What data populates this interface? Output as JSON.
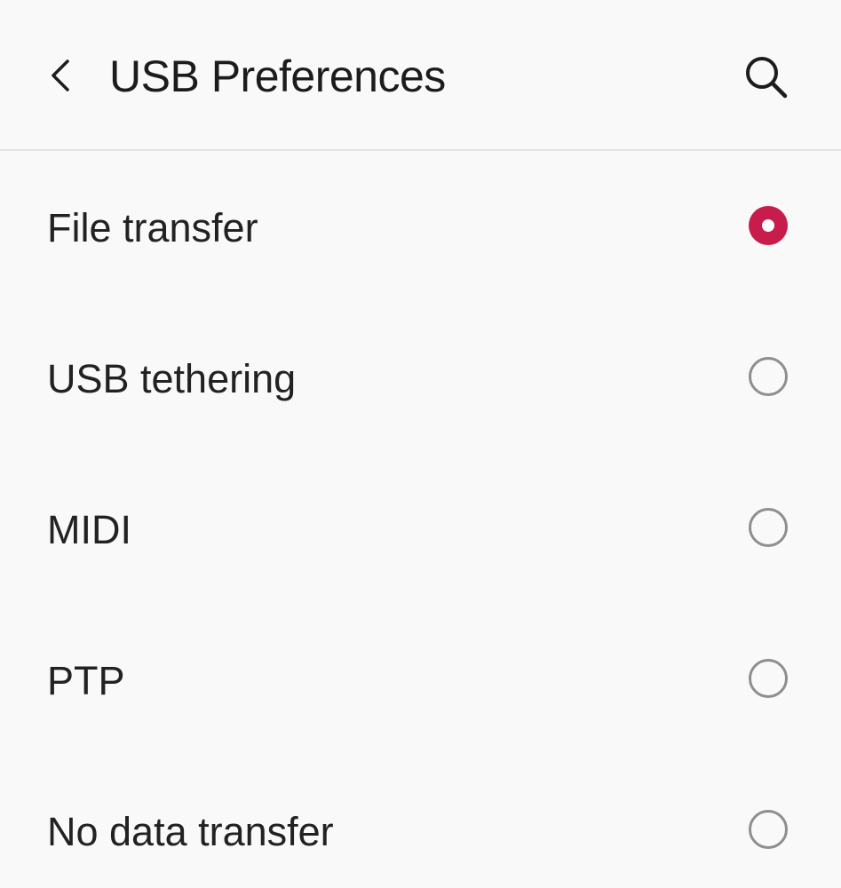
{
  "header": {
    "title": "USB Preferences",
    "back_icon": "chevron-left-icon",
    "search_icon": "search-icon"
  },
  "options": [
    {
      "label": "File transfer",
      "selected": true
    },
    {
      "label": "USB tethering",
      "selected": false
    },
    {
      "label": "MIDI",
      "selected": false
    },
    {
      "label": "PTP",
      "selected": false
    },
    {
      "label": "No data transfer",
      "selected": false
    }
  ],
  "colors": {
    "accent": "#c81d4c",
    "background": "#f9f9f9",
    "text": "#1c1c1c",
    "radio_unselected": "#8e8e8e",
    "divider": "#e2e2e2"
  }
}
